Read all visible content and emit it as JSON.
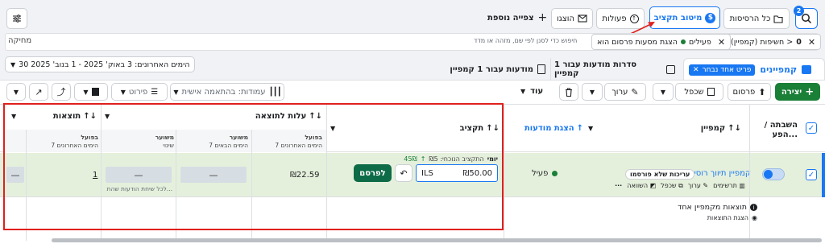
{
  "header": {
    "view_prefix": "חשיפות (קמפיין)",
    "all_versions_label": "כל הרסיסות",
    "budget_opt_label": "מיטוב תקציב",
    "actions_label": "פעולות",
    "hide_label": "הוצגו",
    "add_view_label": "צפייה נוספת",
    "notification_count": "2"
  },
  "filter_bar": {
    "search_placeholder": "מחיקה",
    "filter_hint": "חיפוש כדי לסנן לפי שם, מזהה או מדד",
    "chip1_prefix": "חשיפות (קמפיין) >",
    "chip1_value": "0",
    "chip2_label": "הצגת מסעות פרסום הוא",
    "chip2_status": "פעילים"
  },
  "date_range": "30 הימים האחרונים: 3 באוק' 2025 - 1 בנוב' 2025",
  "tabs": {
    "campaigns": "קמפיינים",
    "selected_chip": "פריט אחד נבחר",
    "adsets": "סדרות מודעות עבור 1 קמפיין",
    "ads": "מודעות עבור 1 קמפיין"
  },
  "toolbar": {
    "create": "יצירה",
    "publish": "פרסום",
    "duplicate": "שכפל",
    "edit": "ערוך",
    "more": "עוד",
    "columns": "עמודות: בהתאמה אישית",
    "breakdown": "פירוט"
  },
  "table": {
    "headers": {
      "onoff": "השבתה / הפע...",
      "campaign": "קמפיין",
      "delivery": "הצגת מודעות",
      "budget": "תקציב",
      "cost": "עלות לתוצאה",
      "results": "תוצאות"
    },
    "subheaders": {
      "cost_actual": "בפועל",
      "cost_actual_sub": "7 הימים האחרונים",
      "cost_projected": "משוער",
      "cost_projected_sub": "7 הימים הבאים",
      "results_projected": "משוער",
      "results_projected_sub": "שינוי",
      "results_actual": "בפועל",
      "results_actual_sub": "7 הימים האחרונים"
    },
    "row": {
      "name": "קמפיין תיווך רוסית",
      "badge": "עריכות שלא פורסמו",
      "actions_charts": "תרשימים",
      "actions_edit": "ערוך",
      "actions_dup": "שכפל",
      "actions_compare": "השוואה",
      "status": "פעיל",
      "budget_hint_prefix": "יומי",
      "budget_hint": "התקציב הנוכחי: ₪5",
      "budget_increase": "45₪",
      "currency": "ILS",
      "budget_value": "₪50.00",
      "publish_btn": "לפרסם",
      "cost_actual": "₪22.59",
      "cost_projected": "—",
      "results_projected": "—",
      "results_projected_note": "לכל שיחת הודעות שהת...",
      "results_actual": "1",
      "results_dash": "—"
    },
    "footer": {
      "title": "תוצאות מקמפיין אחד",
      "sub": "הצגת התוצאות"
    }
  }
}
